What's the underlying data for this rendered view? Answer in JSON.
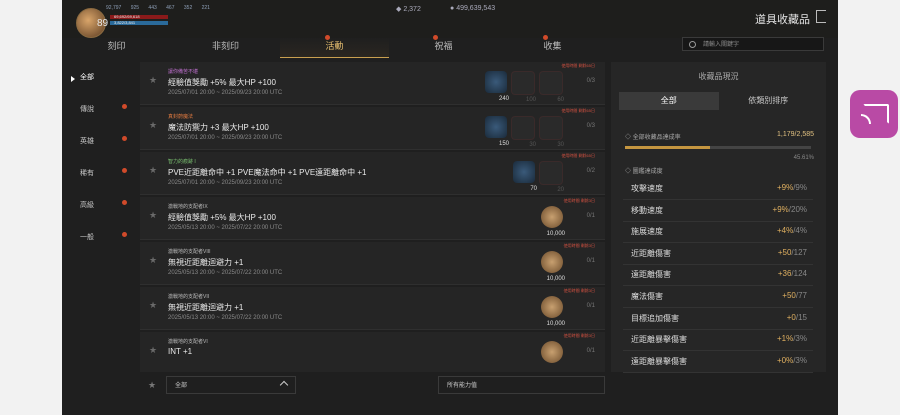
{
  "header": {
    "level": "89",
    "stat1": "92,797",
    "stat2": "925",
    "stat3": "443",
    "stat4": "467",
    "stat5": "352",
    "stat6": "221",
    "hp_text": "69,692/69,618",
    "mp_text": "3,822/3,841",
    "crystals": "2,372",
    "gold": "499,639,543",
    "title": "道具收藏品",
    "exit_icon": "exit-icon"
  },
  "tabs": [
    "刻印",
    "非刻印",
    "活動",
    "祝福",
    "收集"
  ],
  "active_tab": "活動",
  "search": {
    "placeholder": "請輸入關鍵字"
  },
  "sidebar": [
    "全部",
    "傳說",
    "英雄",
    "稀有",
    "高級",
    "一般"
  ],
  "items": [
    {
      "cat": "讓你備苦不堪",
      "cat_color": "#c070d0",
      "name": "經驗值獎勵 +5% 最大HP +100",
      "date": "2025/07/01 20:00 ~ 2025/09/23 20:00 UTC",
      "expire": "使用時間 剩餘65日",
      "counts": [
        "240",
        "100",
        "60"
      ],
      "prog": "0/3",
      "kind": "gem3"
    },
    {
      "cat": "真封蔚魔法",
      "cat_color": "#e07a40",
      "name": "魔法防禦力 +3 最大HP +100",
      "date": "2025/07/01 20:00 ~ 2025/09/23 20:00 UTC",
      "expire": "使用時間 剩餘65日",
      "counts": [
        "150",
        "30",
        "30"
      ],
      "prog": "0/3",
      "kind": "gem3"
    },
    {
      "cat": "智力的痕跡 I",
      "cat_color": "#7ac070",
      "name": "PVE近距離命中 +1 PVE魔法命中 +1 PVE遠距離命中 +1",
      "date": "2025/07/01 20:00 ~ 2025/09/23 20:00 UTC",
      "expire": "使用時間 剩餘65日",
      "counts": [
        "70",
        "20"
      ],
      "prog": "0/2",
      "kind": "gem2"
    },
    {
      "cat": "激戰地的支配者IX",
      "cat_color": "#bbbbbb",
      "name": "經驗值獎勵 +5% 最大HP +100",
      "date": "2025/05/13 20:00 ~ 2025/07/22 20:00 UTC",
      "expire": "使用時間 剩餘3日",
      "counts": [
        "10,000"
      ],
      "prog": "0/1",
      "kind": "coin"
    },
    {
      "cat": "激戰地的支配者VIII",
      "cat_color": "#bbbbbb",
      "name": "無視近距離迴避力 +1",
      "date": "2025/05/13 20:00 ~ 2025/07/22 20:00 UTC",
      "expire": "使用時間 剩餘3日",
      "counts": [
        "10,000"
      ],
      "prog": "0/1",
      "kind": "coin"
    },
    {
      "cat": "激戰地的支配者VII",
      "cat_color": "#bbbbbb",
      "name": "無視近距離迴避力 +1",
      "date": "2025/05/13 20:00 ~ 2025/07/22 20:00 UTC",
      "expire": "使用時間 剩餘3日",
      "counts": [
        "10,000"
      ],
      "prog": "0/1",
      "kind": "coin"
    },
    {
      "cat": "激戰地的支配者VI",
      "cat_color": "#bbbbbb",
      "name": "INT +1",
      "date": "",
      "expire": "使用時間 剩餘3日",
      "counts": [],
      "prog": "0/1",
      "kind": "coin"
    }
  ],
  "bottom": {
    "filter1": "全部",
    "filter2": "所有能力值"
  },
  "panel": {
    "title": "收藏品現況",
    "tab_all": "全部",
    "tab_type": "依類別排序",
    "rate_label": "◇ 全部收藏品達成率",
    "rate_value": "1,179/2,585",
    "rate_fraction": 0.4561,
    "rate_pct": "45.61%",
    "section": "◇ 圖鑑達成度",
    "stats": [
      {
        "label": "攻擊速度",
        "cur": "+9%",
        "max": "/9%"
      },
      {
        "label": "移動速度",
        "cur": "+9%",
        "max": "/20%"
      },
      {
        "label": "施展速度",
        "cur": "+4%",
        "max": "/4%"
      },
      {
        "label": "近距離傷害",
        "cur": "+50",
        "max": "/127"
      },
      {
        "label": "遠距離傷害",
        "cur": "+36",
        "max": "/124"
      },
      {
        "label": "魔法傷害",
        "cur": "+50",
        "max": "/77"
      },
      {
        "label": "目標追加傷害",
        "cur": "+0",
        "max": "/15"
      },
      {
        "label": "近距離暴擊傷害",
        "cur": "+1%",
        "max": "/3%"
      },
      {
        "label": "遠距離暴擊傷害",
        "cur": "+0%",
        "max": "/3%"
      }
    ]
  }
}
